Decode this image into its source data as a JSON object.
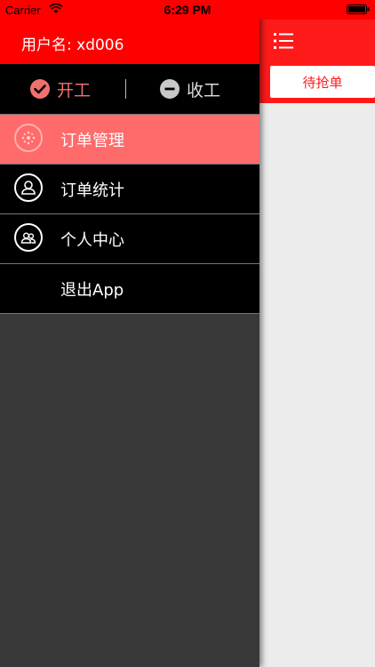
{
  "status_bar": {
    "carrier": "Carrier",
    "time": "6:29 PM"
  },
  "drawer": {
    "username": "用户名: xd006",
    "work_start": "开工",
    "work_stop": "收工",
    "menu": [
      {
        "label": "订单管理",
        "icon": "gear-dots-icon",
        "active": true
      },
      {
        "label": "订单统计",
        "icon": "user-icon",
        "active": false
      },
      {
        "label": "个人中心",
        "icon": "users-icon",
        "active": false
      },
      {
        "label": "退出App",
        "icon": "",
        "active": false
      }
    ]
  },
  "main": {
    "tab_pending": "待抢单"
  },
  "colors": {
    "brand_red": "#ff0000",
    "active_item": "#ff6b6b",
    "drawer_bg": "#393939"
  }
}
